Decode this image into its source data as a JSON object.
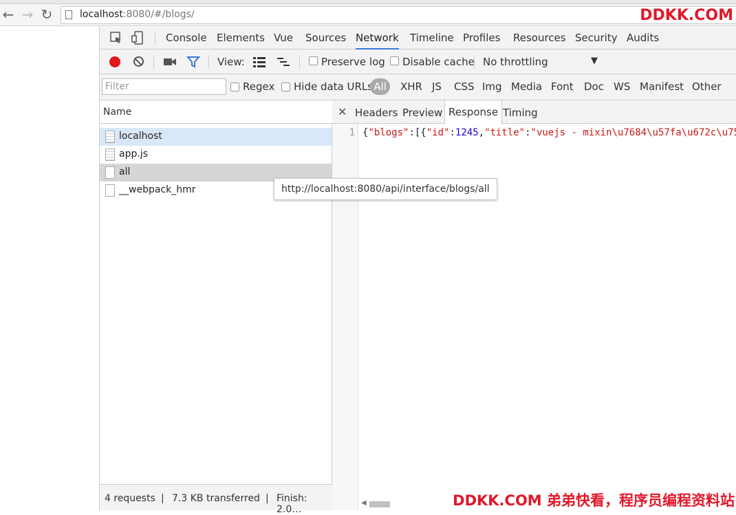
{
  "browser": {
    "url_host": "localhost",
    "url_rest": ":8080/#/blogs/"
  },
  "watermark": {
    "top": "DDKK.COM",
    "bottom": "DDKK.COM 弟弟快看，程序员编程资料站"
  },
  "devtools": {
    "tabs": [
      "Console",
      "Elements",
      "Vue",
      "Sources",
      "Network",
      "Timeline",
      "Profiles",
      "Resources",
      "Security",
      "Audits"
    ],
    "active_tab": "Network"
  },
  "network_toolbar": {
    "view_label": "View:",
    "preserve_log": "Preserve log",
    "disable_cache": "Disable cache",
    "throttling": "No throttling"
  },
  "filter_bar": {
    "placeholder": "Filter",
    "regex": "Regex",
    "hide_data_urls": "Hide data URLs",
    "types": [
      "All",
      "XHR",
      "JS",
      "CSS",
      "Img",
      "Media",
      "Font",
      "Doc",
      "WS",
      "Manifest",
      "Other"
    ]
  },
  "requests": {
    "header": "Name",
    "items": [
      "localhost",
      "app.js",
      "all",
      "__webpack_hmr"
    ]
  },
  "status": {
    "requests": "4 requests",
    "transferred": "7.3 KB transferred",
    "finish": "Finish: 2.0…",
    "sep": "|"
  },
  "detail": {
    "tabs": [
      "Headers",
      "Preview",
      "Response",
      "Timing"
    ],
    "active_tab": "Response",
    "line_number": "1",
    "code": {
      "p1": "{",
      "s1": "\"blogs\"",
      "p2": ":[{",
      "s2": "\"id\"",
      "p3": ":",
      "n1": "1245",
      "p4": ",",
      "s3": "\"title\"",
      "p5": ":",
      "s4": "\"vuejs - mixin\\u7684\\u57fa\\u672c\\u75"
    }
  },
  "tooltip": "http://localhost:8080/api/interface/blogs/all"
}
